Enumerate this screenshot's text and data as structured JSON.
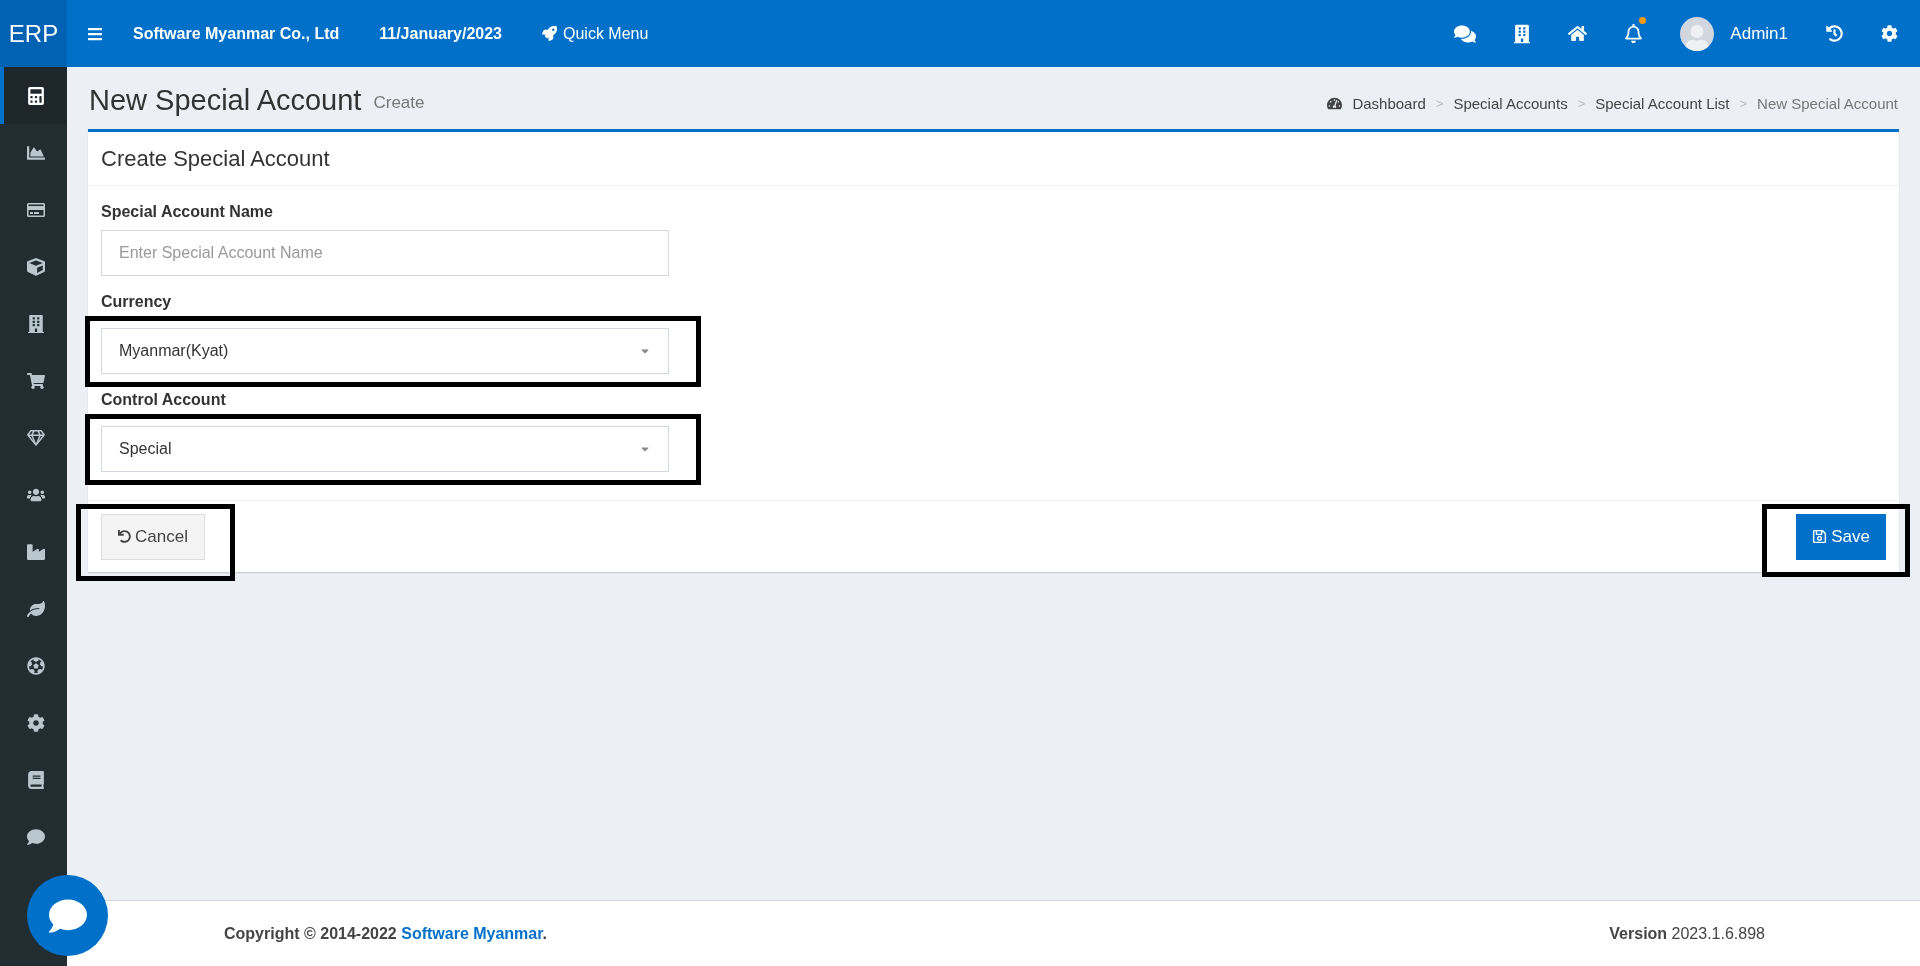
{
  "topbar": {
    "logo": "ERP",
    "company": "Software Myanmar Co., Ltd",
    "date": "11/January/2023",
    "quick_menu": "Quick Menu",
    "notification_dot": true,
    "user": "Admin1"
  },
  "sidebar": {
    "items": [
      {
        "selected": true
      },
      {
        "selected": false
      },
      {
        "selected": false
      },
      {
        "selected": false
      },
      {
        "selected": false
      },
      {
        "selected": false
      },
      {
        "selected": false
      },
      {
        "selected": false
      },
      {
        "selected": false
      },
      {
        "selected": false
      },
      {
        "selected": false
      },
      {
        "selected": false
      },
      {
        "selected": false
      },
      {
        "selected": false
      }
    ]
  },
  "page": {
    "title": "New Special Account",
    "subtitle": "Create"
  },
  "breadcrumb": [
    {
      "label": "Dashboard",
      "current": false
    },
    {
      "label": "Special Accounts",
      "current": false
    },
    {
      "label": "Special Account List",
      "current": false
    },
    {
      "label": "New Special Account",
      "current": true
    }
  ],
  "breadcrumb_separator": ">",
  "card": {
    "title": "Create Special Account",
    "fields": [
      {
        "kind": "input",
        "label": "Special Account Name",
        "placeholder": "Enter Special Account Name"
      },
      {
        "kind": "select",
        "label": "Currency",
        "value": "Myanmar(Kyat)",
        "highlighted": true
      },
      {
        "kind": "select",
        "label": "Control Account",
        "value": "Special",
        "highlighted": true
      }
    ],
    "cancel": {
      "label": "Cancel",
      "highlighted": true
    },
    "save": {
      "label": "Save",
      "highlighted": true
    }
  },
  "footer": {
    "copyright_prefix": "Copyright © 2014-2022",
    "copyright_link": "Software Myanmar",
    "copyright_suffix": ".",
    "version": "**Version** 2023.1.6.898"
  }
}
